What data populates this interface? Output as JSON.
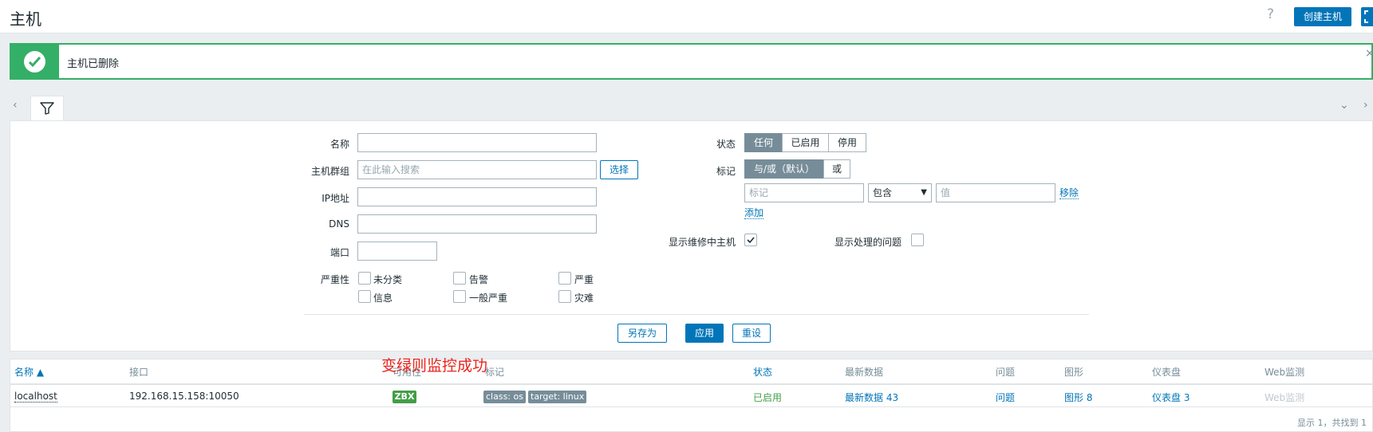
{
  "header": {
    "title": "主机",
    "help_icon": "?",
    "create_label": "创建主机"
  },
  "message": {
    "text": "主机已删除",
    "close": "×"
  },
  "nav": {
    "prev": "‹",
    "collapse": "⌄",
    "next": "›"
  },
  "filter": {
    "name_label": "名称",
    "name_value": "",
    "group_label": "主机群组",
    "group_placeholder": "在此输入搜索",
    "group_select": "选择",
    "ip_label": "IP地址",
    "ip_value": "",
    "dns_label": "DNS",
    "dns_value": "",
    "port_label": "端口",
    "port_value": "",
    "severity_label": "严重性",
    "severities": [
      "未分类",
      "告警",
      "严重",
      "信息",
      "一般严重",
      "灾难"
    ],
    "status_label": "状态",
    "status_options": [
      "任何",
      "已启用",
      "停用"
    ],
    "status_selected": "任何",
    "tags_label": "标记",
    "tag_ops": [
      "与/或（默认）",
      "或"
    ],
    "tag_op_selected": "与/或（默认）",
    "tag_placeholder": "标记",
    "tag_operator": "包含",
    "tag_value_placeholder": "值",
    "remove_label": "移除",
    "add_label": "添加",
    "maint_label": "显示维修中主机",
    "maint_checked": true,
    "suppressed_label": "显示处理的问题",
    "suppressed_checked": false,
    "save_as": "另存为",
    "apply": "应用",
    "reset": "重设"
  },
  "table": {
    "headers": {
      "name": "名称 ▲",
      "interface": "接口",
      "availability": "可用性",
      "tags": "标记",
      "status": "状态",
      "latest": "最新数据",
      "problems": "问题",
      "graphs": "图形",
      "dashboards": "仪表盘",
      "web": "Web监测"
    },
    "rows": [
      {
        "name": "localhost",
        "interface": "192.168.15.158:10050",
        "availability": "ZBX",
        "tags": [
          "class: os",
          "target: linux"
        ],
        "status": "已启用",
        "latest": "最新数据 43",
        "problems": "问题",
        "graphs": "图形 8",
        "dashboards": "仪表盘 3",
        "web": "Web监测"
      }
    ],
    "footer": "显示 1，共找到 1"
  },
  "annotation": "变绿则监控成功",
  "colors": {
    "primary": "#0275b8",
    "success": "#34af67",
    "enabled": "#429e47",
    "annotation": "#e8231d"
  }
}
